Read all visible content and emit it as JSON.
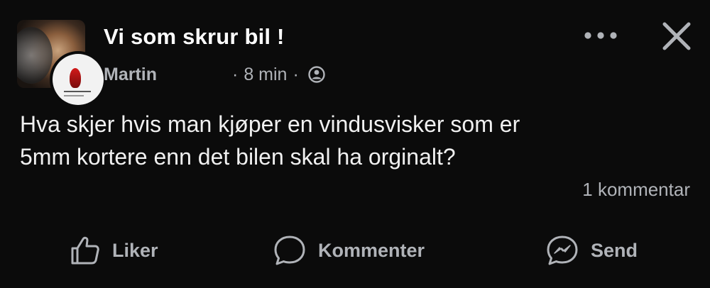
{
  "post": {
    "group_name": "Vi som skrur bil !",
    "author": "Martin",
    "separator": "·",
    "time": "8 min",
    "privacy_icon": "public-globe-icon",
    "more_icon": "more-dots-icon",
    "close_icon": "close-icon",
    "text_line1": "Hva skjer hvis man kjøper en vindusvisker som er",
    "text_line2": "5mm kortere enn det bilen skal ha orginalt?",
    "comment_count": "1 kommentar"
  },
  "actions": {
    "like_label": "Liker",
    "like_icon": "thumbs-up-icon",
    "comment_label": "Kommenter",
    "comment_icon": "speech-bubble-icon",
    "send_label": "Send",
    "send_icon": "messenger-icon"
  },
  "colors": {
    "background": "#0b0b0b",
    "primary_text": "#ffffff",
    "secondary_text": "#b0b3b8"
  }
}
